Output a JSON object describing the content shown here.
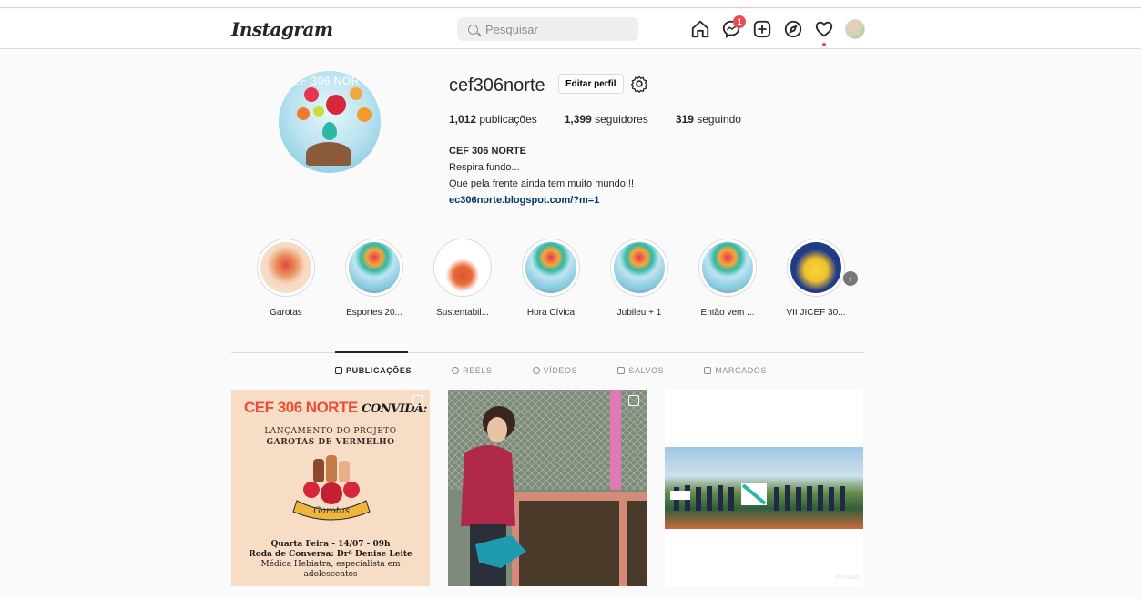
{
  "nav": {
    "logo": "Instagram",
    "search_placeholder": "Pesquisar",
    "messages_badge": "1",
    "icons": [
      "home-icon",
      "messenger-icon",
      "new-post-icon",
      "explore-icon",
      "activity-heart-icon",
      "avatar"
    ]
  },
  "profile": {
    "username": "cef306norte",
    "edit_label": "Editar perfil",
    "avatar_text": "CEF 306 NOR",
    "stats": {
      "posts_count": "1,012",
      "posts_label": "publicações",
      "followers_count": "1,399",
      "followers_label": "seguidores",
      "following_count": "319",
      "following_label": "seguindo"
    },
    "bio": {
      "name": "CEF 306 NORTE",
      "line1": "Respira fundo...",
      "line2": "Que pela frente ainda tem muito mundo!!!",
      "link": "ec306norte.blogspot.com/?m=1"
    }
  },
  "highlights": [
    {
      "label": "Garotas"
    },
    {
      "label": "Esportes 20..."
    },
    {
      "label": "Sustentabil..."
    },
    {
      "label": "Hora Cívica"
    },
    {
      "label": "Jubileu + 1"
    },
    {
      "label": "Então vem ..."
    },
    {
      "label": "VII JICEF 30..."
    }
  ],
  "tabs": [
    {
      "label": "PUBLICAÇÕES",
      "active": true
    },
    {
      "label": "REELS"
    },
    {
      "label": "VÍDEOS"
    },
    {
      "label": "SALVOS"
    },
    {
      "label": "MARCADOS"
    }
  ],
  "posts": {
    "post1": {
      "title": "CEF 306 NORTE",
      "title_suffix": "CONVIDA:",
      "sub1": "LANÇAMENTO DO PROJETO",
      "sub2": "GAROTAS DE VERMELHO",
      "banner": "Garotas",
      "line1": "Quarta Feira - 14/07 - 09h",
      "line2": "Roda de Conversa: Drª Denise Leite",
      "line3": "Médica Hebiatra, especialista em",
      "line4": "adolescentes"
    },
    "post3": {
      "watermark": "Photolab"
    }
  },
  "colors": {
    "accent_red": "#ed4956",
    "link_blue": "#00376b",
    "border": "#dbdbdb",
    "background": "#fafafa"
  }
}
